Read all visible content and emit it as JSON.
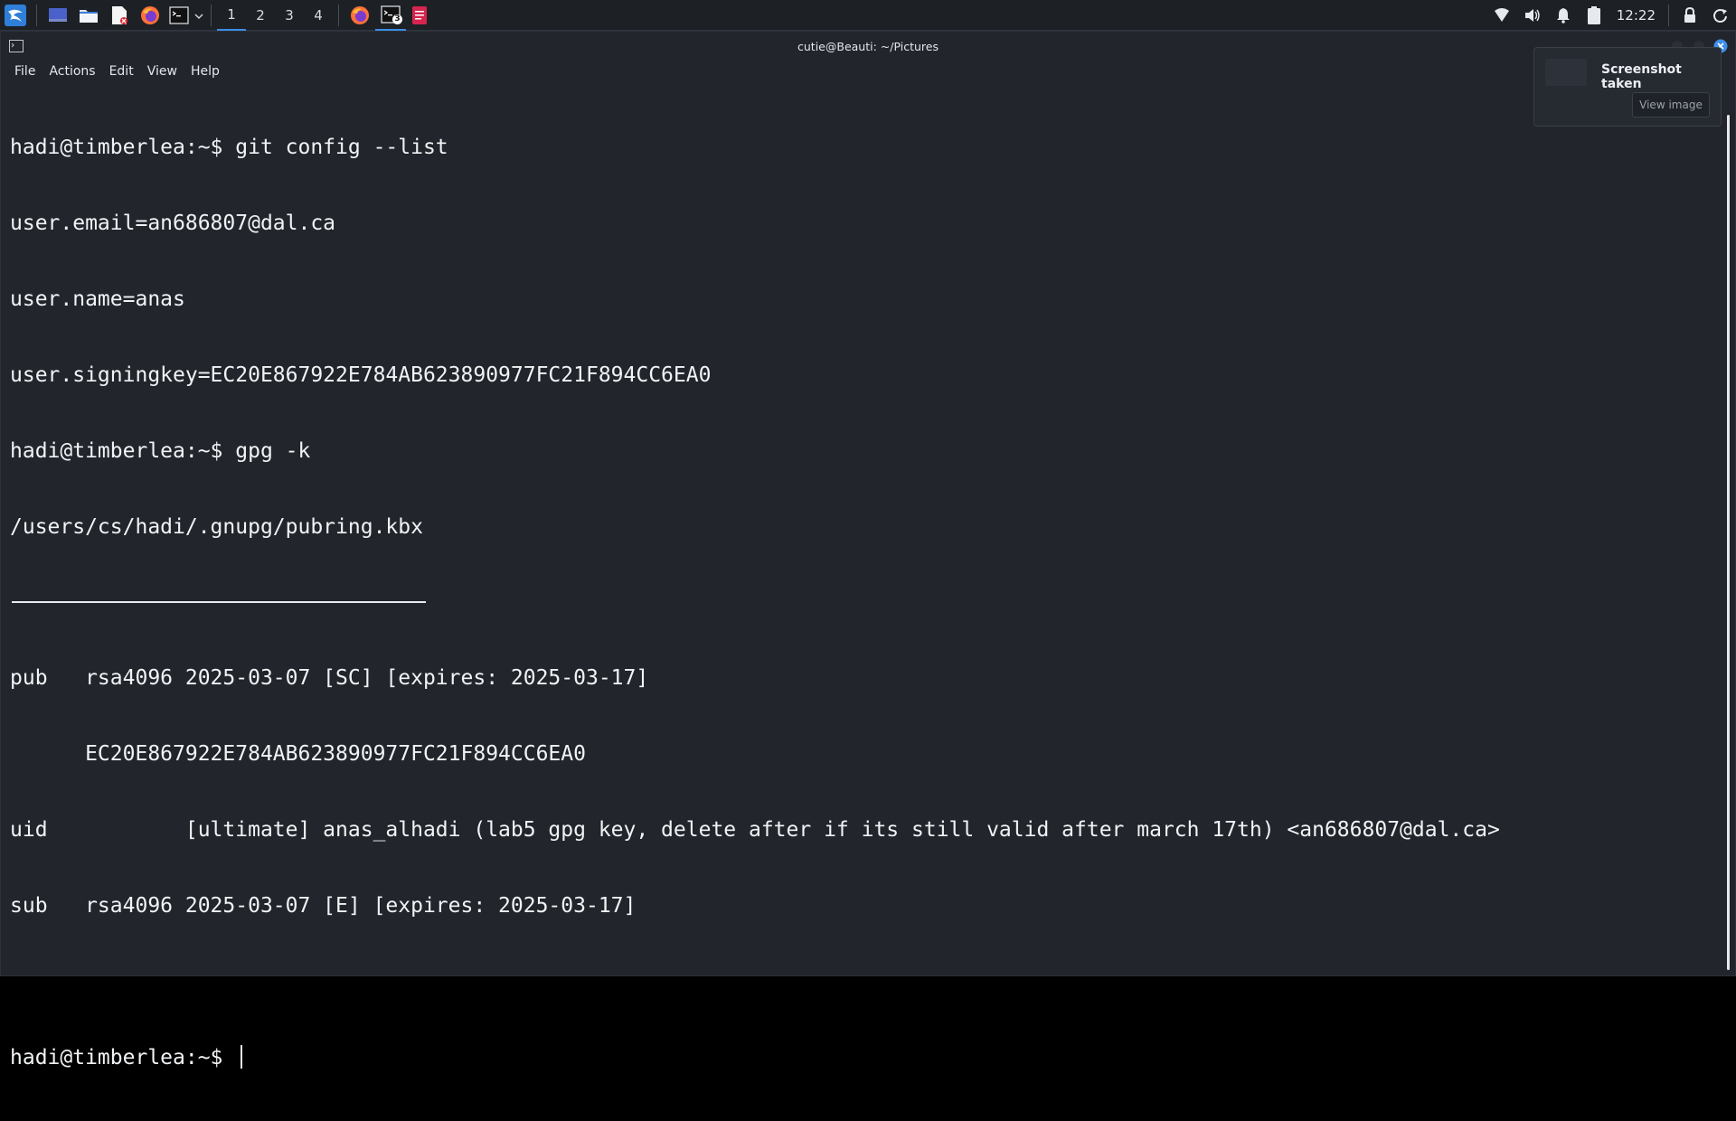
{
  "taskbar": {
    "workspaces": [
      "1",
      "2",
      "3",
      "4"
    ],
    "active_workspace": "1",
    "terminal_badge": "3",
    "clock": "12:22",
    "launchers": [
      "kali-menu-icon",
      "show-desktop-icon",
      "file-manager-icon",
      "text-editor-icon",
      "firefox-icon",
      "terminal-icon"
    ],
    "tray": [
      "wifi-icon",
      "volume-icon",
      "bell-icon",
      "battery-icon",
      "lock-icon",
      "power-icon"
    ]
  },
  "window": {
    "title": "cutie@Beauti: ~/Pictures",
    "menu": [
      "File",
      "Actions",
      "Edit",
      "View",
      "Help"
    ]
  },
  "terminal": {
    "lines": [
      "hadi@timberlea:~$ git config --list",
      "user.email=an686807@dal.ca",
      "user.name=anas",
      "user.signingkey=EC20E867922E784AB623890977FC21F894CC6EA0",
      "hadi@timberlea:~$ gpg -k",
      "/users/cs/hadi/.gnupg/pubring.kbx"
    ],
    "key_lines": [
      "pub   rsa4096 2025-03-07 [SC] [expires: 2025-03-17]",
      "      EC20E867922E784AB623890977FC21F894CC6EA0",
      "uid           [ultimate] anas_alhadi (lab5 gpg key, delete after if its still valid after march 17th) <an686807@dal.ca>",
      "sub   rsa4096 2025-03-07 [E] [expires: 2025-03-17]"
    ],
    "prompt": "hadi@timberlea:~$ "
  },
  "notification": {
    "title": "Screenshot taken",
    "button": "View image"
  },
  "colors": {
    "terminal_bg": "#22252c",
    "taskbar_bg": "#1d2126",
    "accent": "#3b8eea",
    "text": "#f1f3f5"
  }
}
